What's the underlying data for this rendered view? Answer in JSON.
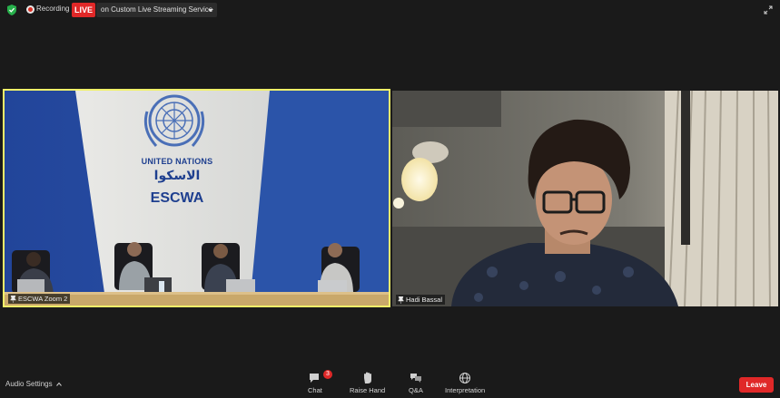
{
  "topbar": {
    "recording_label": "Recording",
    "live_label": "LIVE",
    "stream_service": "on Custom Live Streaming Service",
    "icons": [
      "shield-check-icon",
      "recording-icon",
      "chevron-down-icon",
      "fullscreen-icon"
    ]
  },
  "videos": [
    {
      "name": "ESCWA Zoom 2",
      "active_speaker": true,
      "highlight_color": "#f1f16a"
    },
    {
      "name": "Hadi Bassal",
      "active_speaker": false
    }
  ],
  "backdrop": {
    "org_line1": "UNITED NATIONS",
    "org_arabic": "الاسكوا",
    "org_line2": "ESCWA"
  },
  "toolbar": {
    "audio_settings": "Audio Settings",
    "chat_label": "Chat",
    "chat_badge": "3",
    "raise_hand_label": "Raise Hand",
    "qa_label": "Q&A",
    "interpretation_label": "Interpretation",
    "leave_label": "Leave"
  },
  "colors": {
    "live": "#e02828",
    "leave": "#e02828",
    "shield": "#27b04b",
    "active_border": "#f1f16a"
  }
}
